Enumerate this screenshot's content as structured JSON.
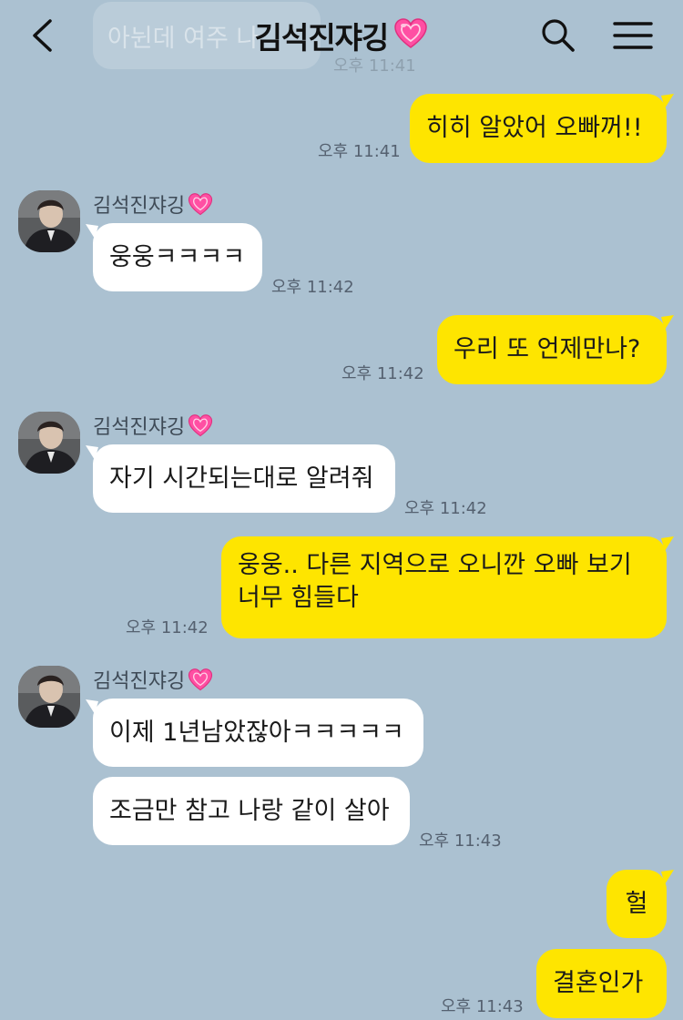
{
  "header": {
    "title": "김석진쟈깅",
    "icons": {
      "back": "chevron-left-icon",
      "search": "search-icon",
      "menu": "hamburger-menu-icon",
      "heart": "sparkling-heart-icon"
    }
  },
  "faded_message": {
    "text": "아뉜데 여주 나",
    "time": "오후 11:41"
  },
  "contact": {
    "name": "김석진쟈깅"
  },
  "messages": [
    {
      "from": "me",
      "text": "히히 알았어 오빠꺼!!",
      "time": "오후 11:41"
    },
    {
      "from": "them",
      "text": "웅웅ㅋㅋㅋㅋ",
      "time": "오후 11:42"
    },
    {
      "from": "me",
      "text": "우리 또 언제만나?",
      "time": "오후 11:42"
    },
    {
      "from": "them",
      "text": "자기 시간되는대로 알려줘",
      "time": "오후 11:42"
    },
    {
      "from": "me",
      "text": "웅웅.. 다른 지역으로 오니깐 오빠 보기 너무 힘들다",
      "line1": "웅웅.. 다른 지역으로 오니깐 오빠 보기",
      "line2": "너무 힘들다",
      "time": "오후 11:42"
    },
    {
      "from": "them",
      "text": "이제 1년남았잖아ㅋㅋㅋㅋㅋ"
    },
    {
      "from": "them",
      "text": "조금만 참고 나랑 같이 살아",
      "time": "오후 11:43"
    },
    {
      "from": "me",
      "text": "헐"
    },
    {
      "from": "me",
      "text": "결혼인가",
      "time": "오후 11:43"
    }
  ],
  "colors": {
    "background": "#abc1d1",
    "my_bubble": "#fee500",
    "their_bubble": "#ffffff",
    "heart": "#ff4fa3"
  }
}
